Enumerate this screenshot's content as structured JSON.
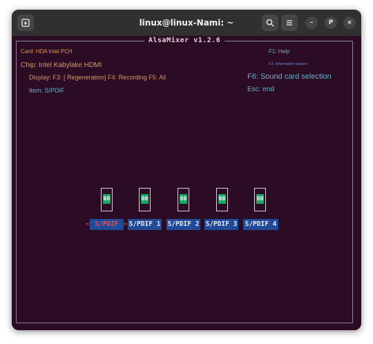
{
  "window": {
    "title": "linux@linux-Nami: ~"
  },
  "titlebar": {
    "new_tab_icon": "new-tab-icon",
    "search_icon": "search-icon",
    "menu_icon": "hamburger-menu-icon",
    "minimize_label": "–",
    "maximize_label": "P",
    "close_label": "×"
  },
  "alsamixer": {
    "title": "AlsaMixer v1.2.6",
    "card_line": "Card: HDA Intel PCH",
    "chip_line": "Chip: Intel Kabylake HDMI",
    "view_line": "Display: F3: [ Regeneration] F4: Recording F5: All",
    "item_line": "Item: S/PDIF",
    "help_f1": "F1: Help",
    "help_f2": "F2: Information system",
    "help_f6": "F6: Sound card selection",
    "help_esc": "Esc: end",
    "left_marker": "<",
    "right_marker": ">",
    "channels": [
      {
        "label": "S/PDIF",
        "value": "00",
        "selected": true
      },
      {
        "label": "S/PDIF 1",
        "value": "00",
        "selected": false
      },
      {
        "label": "S/PDIF 2",
        "value": "00",
        "selected": false
      },
      {
        "label": "S/PDIF 3",
        "value": "00",
        "selected": false
      },
      {
        "label": "S/PDIF 4",
        "value": "00",
        "selected": false
      }
    ]
  },
  "colors": {
    "background": "#2c0b24",
    "header_orange": "#d99a5f",
    "help_cyan": "#66b3cc",
    "label_bg": "#214a98",
    "value_green": "#1fa865",
    "selected_red": "#e05050"
  }
}
